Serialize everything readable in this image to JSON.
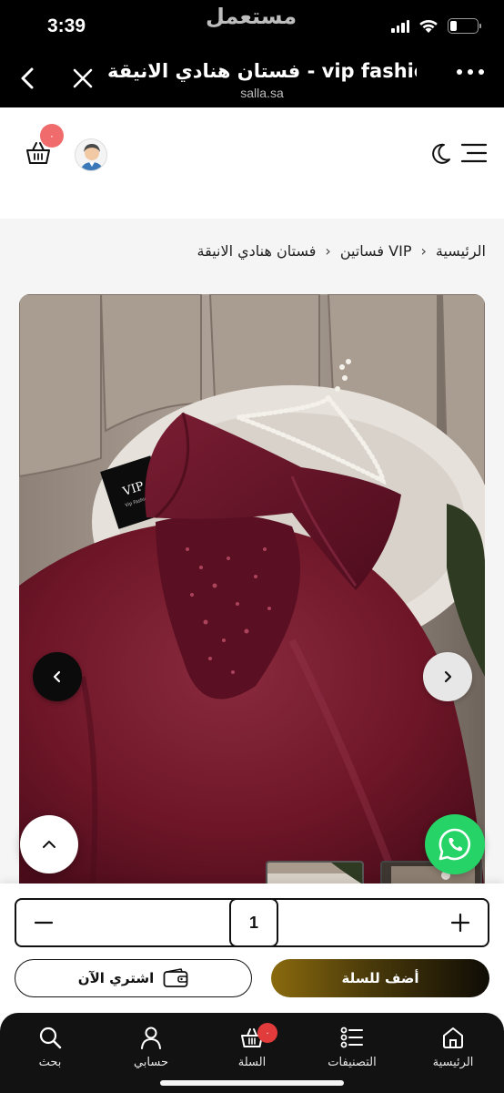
{
  "status_bar": {
    "time": "3:39",
    "watermark": "مستعمل",
    "battery_level": 0.25
  },
  "browser": {
    "title": "فستان هنادي الانيقة - vip fashion",
    "domain": "salla.sa",
    "icons": [
      "chevron-left-icon",
      "close-icon",
      "more-icon"
    ]
  },
  "header": {
    "cart_badge": "٠",
    "icons": [
      "cart-icon",
      "avatar",
      "moon-icon",
      "menu-icon"
    ]
  },
  "breadcrumb": {
    "items": [
      "الرئيسية",
      "فساتين VIP",
      "فستان هنادي الانيقة"
    ],
    "separator": "›"
  },
  "gallery": {
    "hanger_tag": "VIP",
    "hanger_tag_sub": "Vip Fashion",
    "dress_color": "#7a1a30"
  },
  "purchase": {
    "quantity": "1",
    "buy_now_label": "اشتري الآن",
    "add_to_cart_label": "أضف للسلة"
  },
  "bottom_nav": {
    "items": [
      {
        "label": "الرئيسية",
        "icon": "home-icon"
      },
      {
        "label": "التصنيفات",
        "icon": "categories-icon"
      },
      {
        "label": "السلة",
        "icon": "cart-icon",
        "badge": "٠"
      },
      {
        "label": "حسابي",
        "icon": "user-icon"
      },
      {
        "label": "بحث",
        "icon": "search-icon"
      }
    ]
  },
  "colors": {
    "accent_gold": "#8a6a0e",
    "badge_red": "#e23b3b",
    "whatsapp_green": "#25d366"
  }
}
